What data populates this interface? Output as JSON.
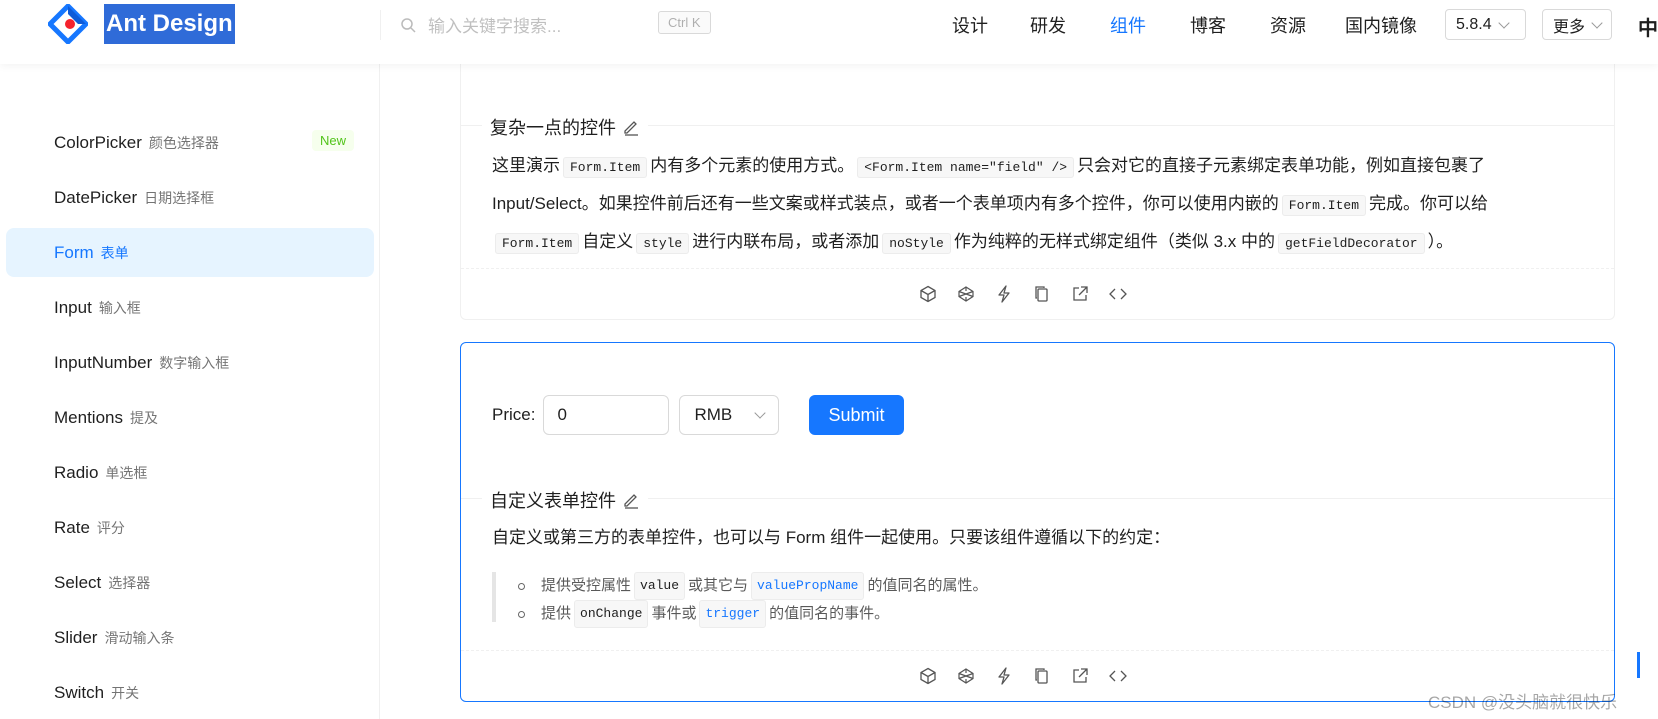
{
  "header": {
    "brand": "Ant Design",
    "search_placeholder": "输入关键字搜索...",
    "shortcut": "Ctrl K",
    "nav": [
      "设计",
      "研发",
      "组件",
      "博客",
      "资源",
      "国内镜像"
    ],
    "active_nav": "组件",
    "version": "5.8.4",
    "more": "更多",
    "lang": "中"
  },
  "sidebar": {
    "items": [
      {
        "en": "ColorPicker",
        "zh": "颜色选择器",
        "badge": "New"
      },
      {
        "en": "DatePicker",
        "zh": "日期选择框"
      },
      {
        "en": "Form",
        "zh": "表单",
        "active": true
      },
      {
        "en": "Input",
        "zh": "输入框"
      },
      {
        "en": "InputNumber",
        "zh": "数字输入框"
      },
      {
        "en": "Mentions",
        "zh": "提及"
      },
      {
        "en": "Radio",
        "zh": "单选框"
      },
      {
        "en": "Rate",
        "zh": "评分"
      },
      {
        "en": "Select",
        "zh": "选择器"
      },
      {
        "en": "Slider",
        "zh": "滑动输入条"
      },
      {
        "en": "Switch",
        "zh": "开关"
      }
    ]
  },
  "demo1": {
    "title": "复杂一点的控件",
    "p1_a": "这里演示",
    "code_form_item": "Form.Item",
    "p1_b": "内有多个元素的使用方式。",
    "code_field": "<Form.Item name=\"field\" />",
    "p1_c": "只会对它的直接子元素绑定表单功能，例如直接包裹了",
    "p2_a": "Input/Select。如果控件前后还有一些文案或样式装点，或者一个表单项内有多个控件，你可以使用内嵌的",
    "p2_b": "完成。你可以给",
    "p3_a": "自定义",
    "code_style": "style",
    "p3_b": "进行内联布局，或者添加",
    "code_nostyle": "noStyle",
    "p3_c": "作为纯粹的无样式绑定组件（类似 3.x 中的",
    "code_gfd": "getFieldDecorator",
    "p3_d": "）。"
  },
  "demo2": {
    "price_label": "Price",
    "price_value": "0",
    "currency": "RMB",
    "submit": "Submit",
    "title": "自定义表单控件",
    "desc": "自定义或第三方的表单控件，也可以与 Form 组件一起使用。只要该组件遵循以下的约定：",
    "li1_a": "提供受控属性",
    "code_value": "value",
    "li1_b": "或其它与",
    "code_vpn": "valuePropName",
    "li1_c": "的值同名的属性。",
    "li2_a": "提供",
    "code_onchange": "onChange",
    "li2_b": "事件或",
    "code_trigger": "trigger",
    "li2_c": "的值同名的事件。"
  },
  "watermark": "CSDN @没头脑就很快乐",
  "colors": {
    "primary": "#1677ff",
    "brand_highlight": "#2f6bd8",
    "new_badge": "#52c41a"
  }
}
